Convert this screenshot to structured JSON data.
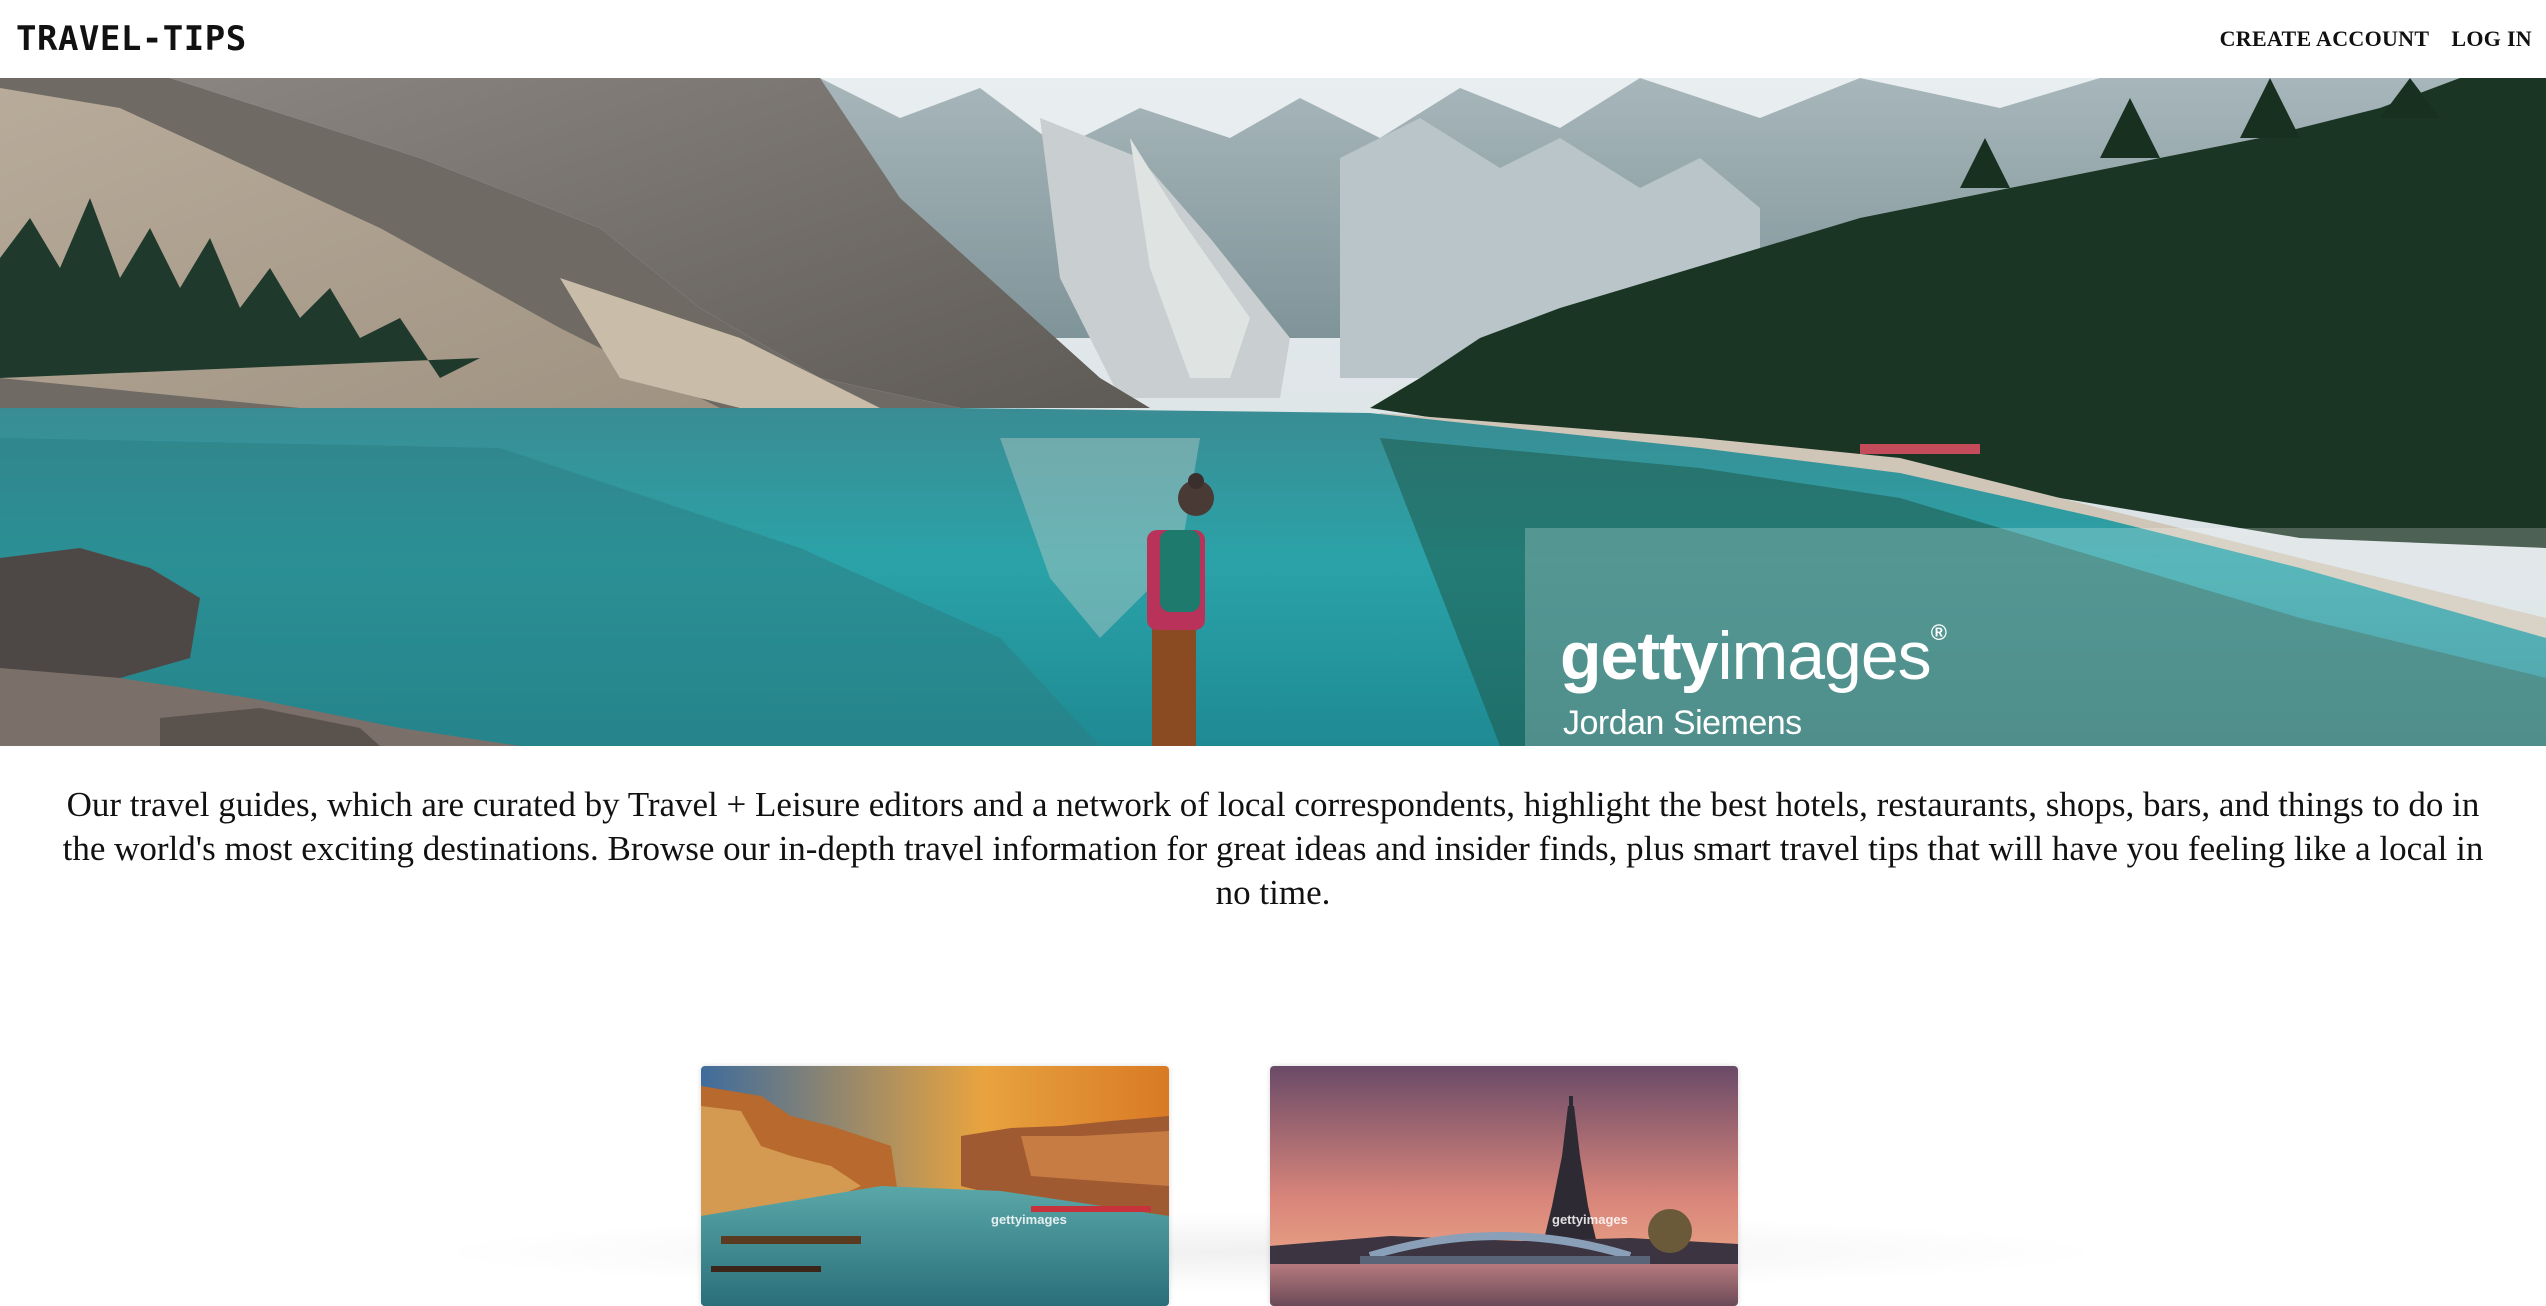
{
  "header": {
    "logo": "TRAVEL-TIPS",
    "create_account": "CREATE ACCOUNT",
    "log_in": "LOG IN"
  },
  "hero": {
    "watermark_brand_bold": "getty",
    "watermark_brand_light": "images",
    "watermark_registered": "®",
    "watermark_credit": "Jordan Siemens"
  },
  "intro": {
    "text": "Our travel guides, which are curated by Travel + Leisure editors and a network of local correspondents, highlight the best hotels, restaurants, shops, bars, and things to do in the world's most exciting destinations. Browse our in-depth travel information for great ideas and insider finds, plus smart travel tips that will have you feeling like a local in no time."
  },
  "cards": [
    {
      "watermark": "gettyimages"
    },
    {
      "watermark": "gettyimages"
    }
  ]
}
